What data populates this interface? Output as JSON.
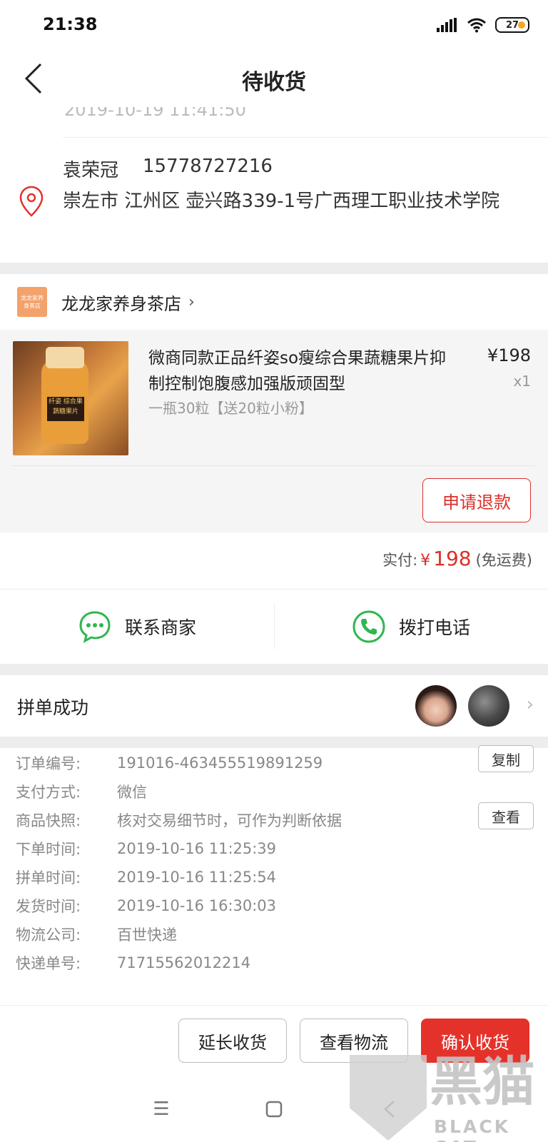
{
  "status_bar": {
    "time": "21:38",
    "battery": "27"
  },
  "nav": {
    "title": "待收货"
  },
  "address": {
    "clipped_time": "2019-10-19 11:41:50",
    "name": "袁荣冠",
    "phone": "15778727216",
    "full_address": "崇左市 江州区 壶兴路339-1号广西理工职业技术学院"
  },
  "shop": {
    "logo_text": "龙龙家养身茶店",
    "name": "龙龙家养身茶店",
    "product": {
      "title": "微商同款正品纤姿so瘦综合果蔬糖果片抑制控制饱腹感加强版顽固型",
      "spec": "一瓶30粒【送20粒小粉】",
      "price": "¥198",
      "qty": "x1",
      "image_label": "纤姿 综合果蔬糖果片"
    },
    "refund_label": "申请退款"
  },
  "payment": {
    "label": "实付:",
    "currency": "¥",
    "amount": "198",
    "note": "(免运费)"
  },
  "contact": {
    "merchant_label": "联系商家",
    "call_label": "拨打电话"
  },
  "group": {
    "label": "拼单成功"
  },
  "details": {
    "rows": [
      {
        "label": "订单编号:",
        "value": "191016-463455519891259"
      },
      {
        "label": "支付方式:",
        "value": "微信"
      },
      {
        "label": "商品快照:",
        "value": "核对交易细节时，可作为判断依据"
      },
      {
        "label": "下单时间:",
        "value": "2019-10-16 11:25:39"
      },
      {
        "label": "拼单时间:",
        "value": "2019-10-16 11:25:54"
      },
      {
        "label": "发货时间:",
        "value": "2019-10-16 16:30:03"
      },
      {
        "label": "物流公司:",
        "value": "百世快递"
      },
      {
        "label": "快递单号:",
        "value": "71715562012214"
      }
    ],
    "copy_label": "复制",
    "view_label": "查看"
  },
  "actions": {
    "extend": "延长收货",
    "logistics": "查看物流",
    "confirm": "确认收货"
  },
  "watermark": {
    "text": "黑猫",
    "sub": "BLACK CAT"
  },
  "colors": {
    "accent_red": "#e4322b",
    "wechat_green": "#2fb650"
  }
}
